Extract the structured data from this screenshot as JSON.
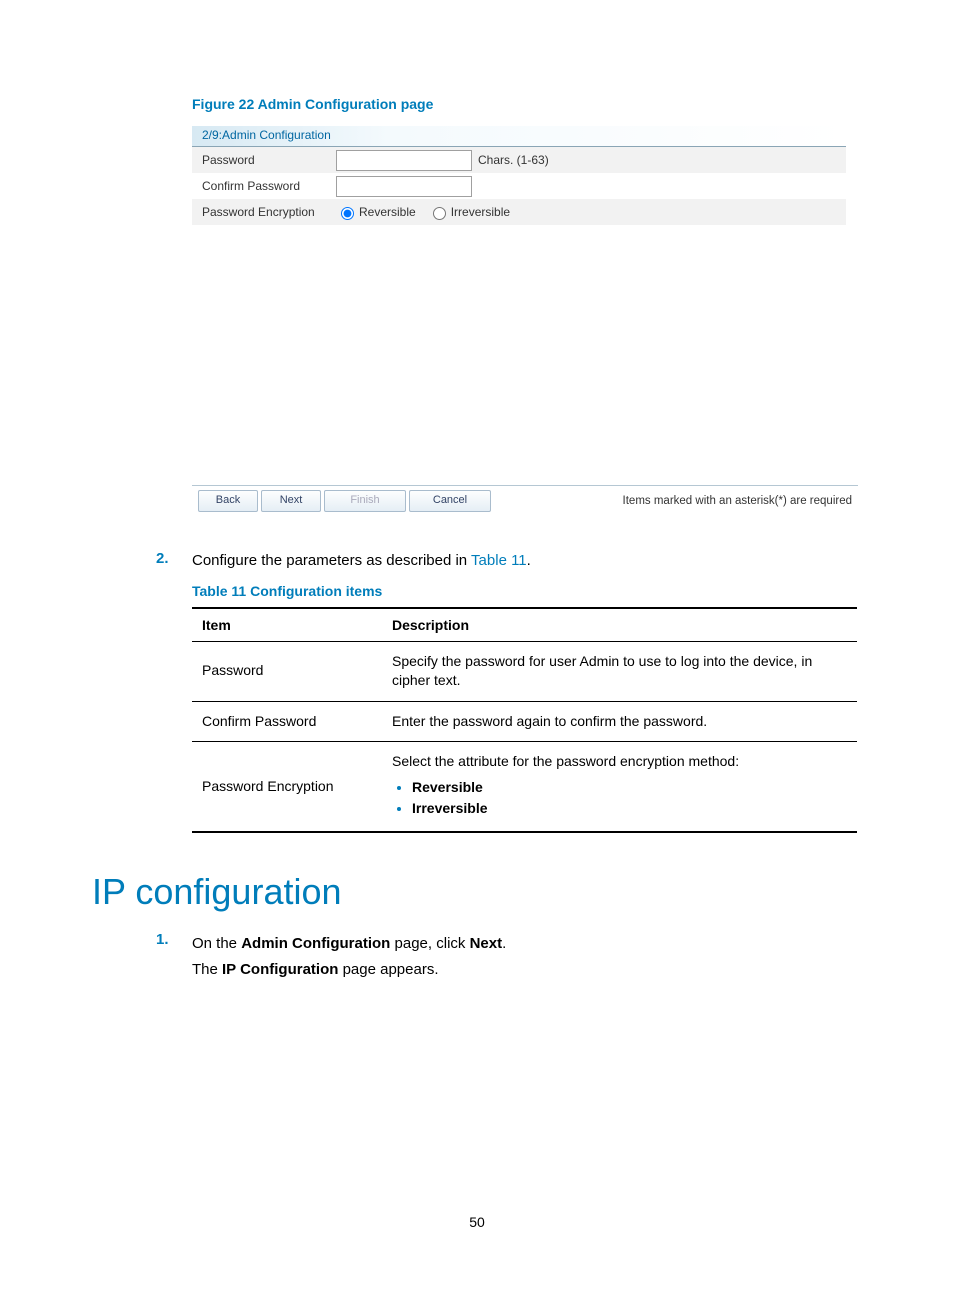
{
  "figure": {
    "caption": "Figure 22 Admin Configuration page"
  },
  "panel": {
    "header": "2/9:Admin Configuration",
    "rows": {
      "password": {
        "label": "Password",
        "hint": "Chars. (1-63)"
      },
      "confirm": {
        "label": "Confirm Password"
      },
      "encryption": {
        "label": "Password Encryption",
        "opt1": "Reversible",
        "opt2": "Irreversible"
      }
    },
    "footer": {
      "back": "Back",
      "next": "Next",
      "finish": "Finish",
      "cancel": "Cancel",
      "required_note": "Items marked with an asterisk(*) are required"
    }
  },
  "step2": {
    "num": "2.",
    "text_before": "Configure the parameters as described in ",
    "link": "Table 11",
    "text_after": "."
  },
  "table": {
    "caption": "Table 11 Configuration items",
    "head": {
      "item": "Item",
      "desc": "Description"
    },
    "rows": [
      {
        "item": "Password",
        "desc": "Specify the password for user Admin to use to log into the device, in cipher text."
      },
      {
        "item": "Confirm Password",
        "desc": "Enter the password again to confirm the password."
      }
    ],
    "row3": {
      "item": "Password Encryption",
      "intro": "Select the attribute for the password encryption method:",
      "b1": "Reversible",
      "b2": "Irreversible"
    }
  },
  "heading": "IP configuration",
  "ip_step1": {
    "num": "1.",
    "line1_a": "On the ",
    "line1_b": "Admin Configuration",
    "line1_c": " page, click ",
    "line1_d": "Next",
    "line1_e": ".",
    "line2_a": "The ",
    "line2_b": "IP Configuration",
    "line2_c": " page appears."
  },
  "page_number": "50"
}
